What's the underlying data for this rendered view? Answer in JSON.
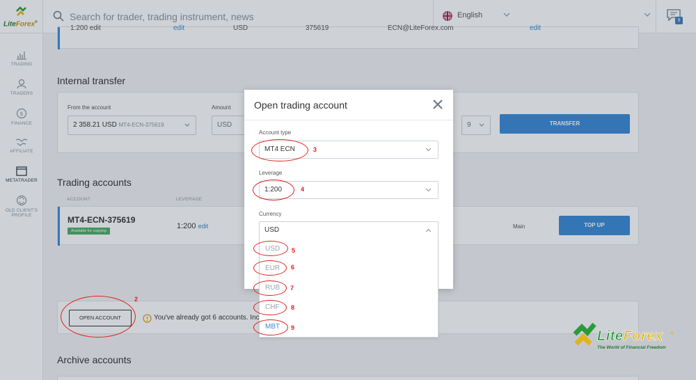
{
  "brand": {
    "logo_left": "Lite",
    "logo_right": "Forex",
    "logo_reg": "®",
    "tagline": "The World of Financial Freedom"
  },
  "sidebar": {
    "items": [
      {
        "label": "TRADING",
        "icon": "chart-bars-icon"
      },
      {
        "label": "TRADERS",
        "icon": "user-icon"
      },
      {
        "label": "FINANCE",
        "icon": "dollar-icon"
      },
      {
        "label": "AFFILIATE",
        "icon": "handshake-icon"
      },
      {
        "label": "METATRADER",
        "icon": "window-icon"
      },
      {
        "label_line1": "OLD CLIENT'S",
        "label_line2": "PROFILE",
        "icon": "refresh-icon"
      }
    ]
  },
  "header": {
    "search_placeholder": "Search for trader, trading instrument, news",
    "language": "English",
    "chat_badge": "9"
  },
  "top_row": {
    "c1": "1:200 edit",
    "c2": "edit",
    "c3": "USD",
    "c4": "375619",
    "c5": "ECN@LiteForex.com",
    "c6": "edit"
  },
  "internal_transfer": {
    "title": "Internal transfer",
    "from_label": "From the account",
    "from_amount": "2 358.21 USD",
    "from_account": "MT4-ECN-375619",
    "amount_label": "Amount",
    "amount_currency": "USD",
    "to_partial": "9",
    "transfer_button": "TRANSFER"
  },
  "trading_accounts": {
    "title": "Trading accounts",
    "col_account": "ACCOUNT",
    "col_leverage": "LEVERAGE",
    "account_name": "MT4-ECN-375619",
    "badge": "Available for copying",
    "leverage": "1:200",
    "edit": "edit",
    "type": "Main",
    "topup_button": "TOP UP"
  },
  "open_account": {
    "button": "OPEN ACCOUNT",
    "message": "You've already got 6 accounts. Incl"
  },
  "archive": {
    "title": "Archive accounts"
  },
  "modal": {
    "title": "Open trading account",
    "account_type_label": "Account type",
    "account_type_value": "MT4 ECN",
    "leverage_label": "Leverage",
    "leverage_value": "1:200",
    "currency_label": "Currency",
    "currency_value": "USD",
    "currency_options": [
      "USD",
      "EUR",
      "RUB",
      "CHF",
      "MBT"
    ]
  },
  "annotations": {
    "n2": "2",
    "n3": "3",
    "n4": "4",
    "n5": "5",
    "n6": "6",
    "n7": "7",
    "n8": "8",
    "n9": "9"
  },
  "colors": {
    "accent": "#3a8bd6",
    "annotation": "#e0201c",
    "badge_green": "#4caf6a",
    "brand_green": "#2b9b3a",
    "brand_gold": "#e2b416"
  }
}
